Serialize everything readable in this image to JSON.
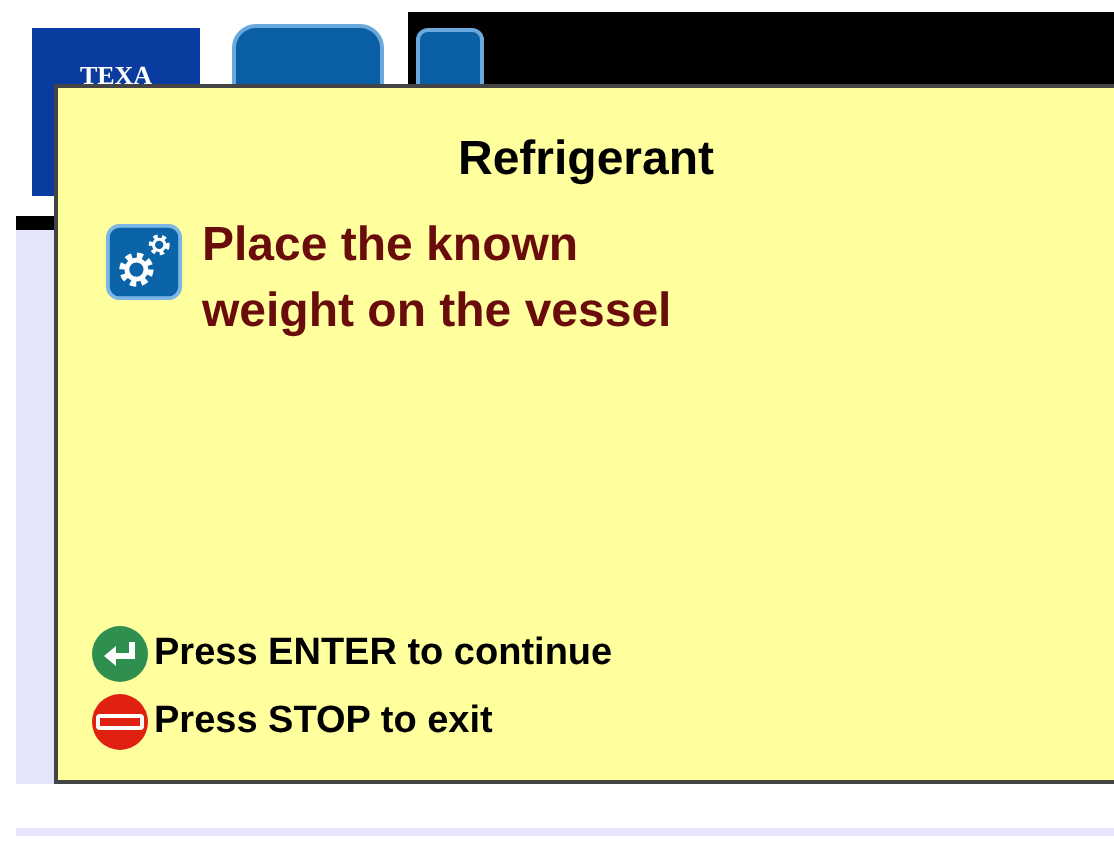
{
  "logo": {
    "text": "TEXA"
  },
  "dialog": {
    "title": "Refrigerant",
    "message": "Place the known weight on the vessel",
    "actions": [
      {
        "kind": "enter",
        "label": "Press ENTER to continue"
      },
      {
        "kind": "stop",
        "label": "Press STOP to exit"
      }
    ]
  }
}
